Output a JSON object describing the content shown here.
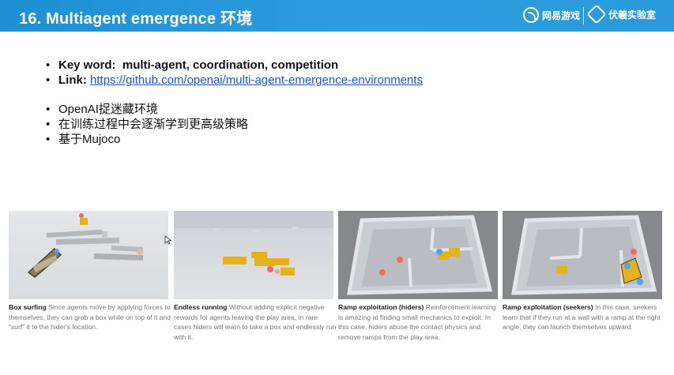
{
  "header": {
    "title": "16. Multiagent emergence 环境",
    "logo_primary": "网易游戏",
    "logo_secondary": "伏羲实验室",
    "background_color": "#2a97d8"
  },
  "bullets": {
    "keyword_label": "Key word:",
    "keyword_value": "multi-agent, coordination, competition",
    "link_label": "Link:",
    "link_url": "https://github.com/openai/multi-agent-emergence-environments",
    "items": [
      "OpenAI捉迷藏环境",
      "在训练过程中会逐渐学到更高级策略",
      "基于Mujoco"
    ]
  },
  "panels": [
    {
      "title": "Box surfing",
      "text": "Since agents move by applying forces to themselves, they can grab a box while on top of it and “surf” it to the hider's location."
    },
    {
      "title": "Endless running",
      "text": "Without adding explicit negative rewards for agents leaving the play area, in rare cases hiders will learn to take a box and endlessly run with it."
    },
    {
      "title": "Ramp exploitation (hiders)",
      "text": "Reinforcement learning is amazing at finding small mechanics to exploit. In this case, hiders abuse the contact physics and remove ramps from the play area."
    },
    {
      "title": "Ramp exploitation (seekers)",
      "text": "In this case, seekers learn that if they run at a wall with a ramp at the right angle, they can launch themselves upward."
    }
  ],
  "colors": {
    "link": "#1a56c8",
    "box": "#e6b21a",
    "agent_red": "#f06c5a",
    "agent_blue": "#4aa8e8"
  }
}
